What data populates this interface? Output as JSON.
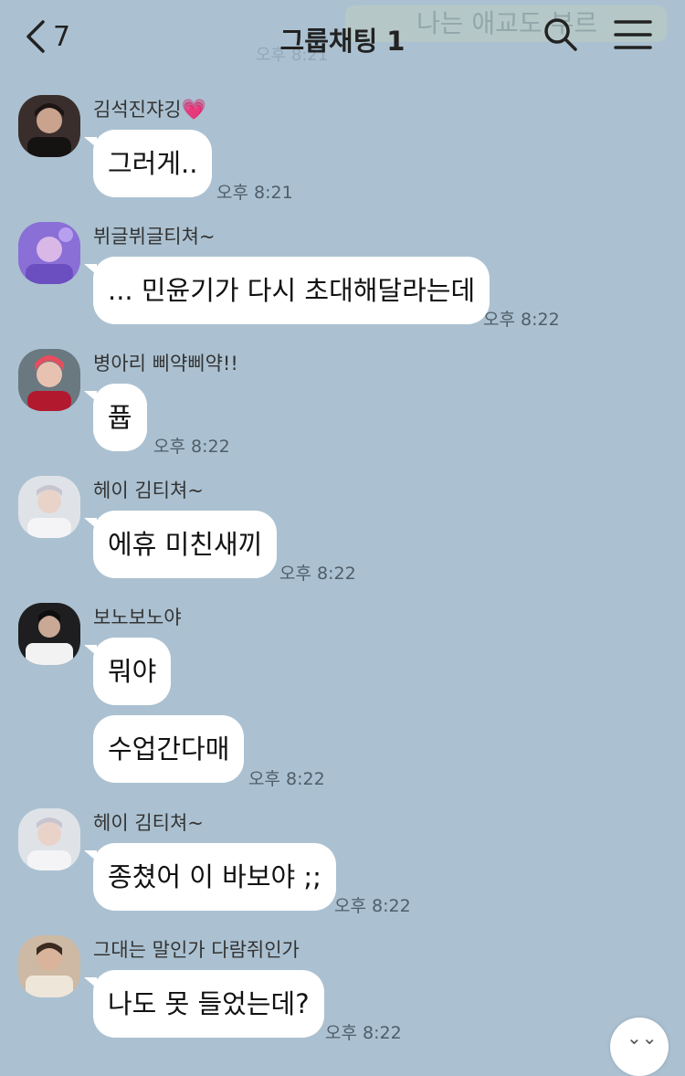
{
  "header": {
    "back_count": "7",
    "title": "그룹채팅",
    "member_count": "1",
    "notice_ghost": "나는 애교도 부르",
    "time_ghost": "오후 8:21"
  },
  "messages": [
    {
      "sender": "김석진쟈깅",
      "heart": "💗",
      "text": "그러게..",
      "time": "오후 8:21"
    },
    {
      "sender": "뷔글뷔글티쳐~",
      "text": "... 민윤기가 다시 초대해달라는데",
      "time": "오후 8:22"
    },
    {
      "sender": "병아리 삐약삐약!!",
      "text": "퓹",
      "time": "오후 8:22"
    },
    {
      "sender": "헤이 김티쳐~",
      "text": "에휴 미친새끼",
      "time": "오후 8:22"
    },
    {
      "sender": "보노보노야",
      "text": "뭐야",
      "text2": "수업간다매",
      "time": "오후 8:22"
    },
    {
      "sender": "헤이 김티쳐~",
      "text": "종쳤어 이 바보야 ;;",
      "time": "오후 8:22"
    },
    {
      "sender": "그대는 말인가 다람쥐인가",
      "text": "나도 못 들었는데?",
      "time": "오후 8:22"
    }
  ],
  "scroll_button": {
    "icon": "chevron-down-icon"
  },
  "colors": {
    "background": "#abc1d1",
    "bubble": "#ffffff",
    "heart": "#e84a91"
  }
}
